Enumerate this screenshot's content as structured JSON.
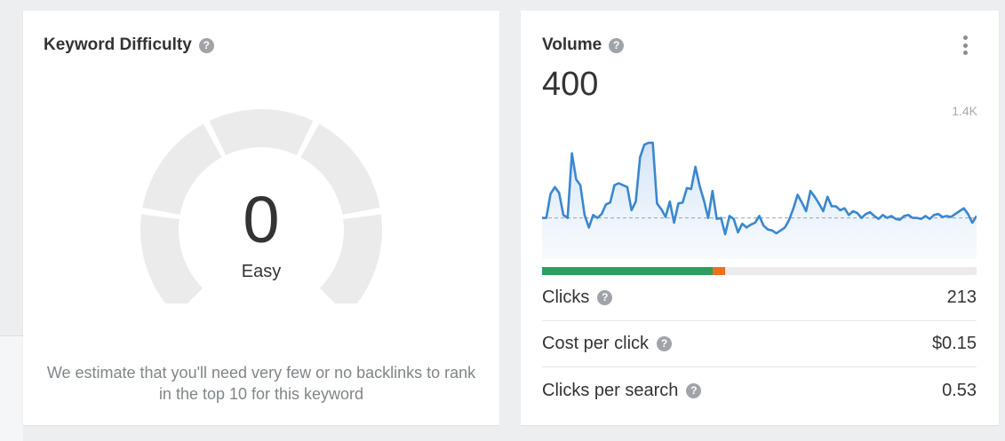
{
  "keyword_difficulty": {
    "title": "Keyword Difficulty",
    "help_icon": "?",
    "score": "0",
    "score_label": "Easy",
    "description": "We estimate that you'll need very few or no backlinks to rank in the top 10 for this keyword"
  },
  "volume": {
    "title": "Volume",
    "help_icon": "?",
    "value": "400",
    "axis_max_label": "1.4K",
    "menu_icon": "kebab-menu-icon",
    "line_color": "#3a87cf",
    "split": {
      "segments": [
        {
          "fraction": 0.392,
          "color": "#2e9e5e"
        },
        {
          "fraction": 0.03,
          "color": "#f07020"
        }
      ],
      "track_color": "#ebebeb"
    },
    "metrics": [
      {
        "label": "Clicks",
        "value": "213"
      },
      {
        "label": "Cost per click",
        "value": "$0.15"
      },
      {
        "label": "Clicks per search",
        "value": "0.53"
      }
    ]
  },
  "chart_data": {
    "type": "area",
    "ylim": [
      0,
      1400
    ],
    "average": 400,
    "ytick_labels": [
      "1.4K"
    ],
    "values": [
      400,
      400,
      650,
      720,
      660,
      430,
      400,
      1070,
      800,
      740,
      430,
      300,
      430,
      400,
      440,
      540,
      560,
      740,
      760,
      740,
      720,
      480,
      570,
      1030,
      1160,
      1180,
      1180,
      550,
      490,
      410,
      570,
      350,
      550,
      560,
      710,
      700,
      930,
      730,
      580,
      400,
      680,
      390,
      400,
      230,
      420,
      390,
      250,
      340,
      300,
      330,
      350,
      420,
      320,
      280,
      270,
      240,
      270,
      300,
      380,
      500,
      640,
      560,
      470,
      680,
      620,
      550,
      470,
      620,
      520,
      520,
      480,
      500,
      430,
      470,
      450,
      400,
      440,
      460,
      420,
      390,
      430,
      400,
      420,
      390,
      380,
      420,
      430,
      400,
      400,
      390,
      420,
      390,
      430,
      440,
      410,
      420,
      410,
      440,
      470,
      500,
      440,
      350,
      420
    ]
  }
}
